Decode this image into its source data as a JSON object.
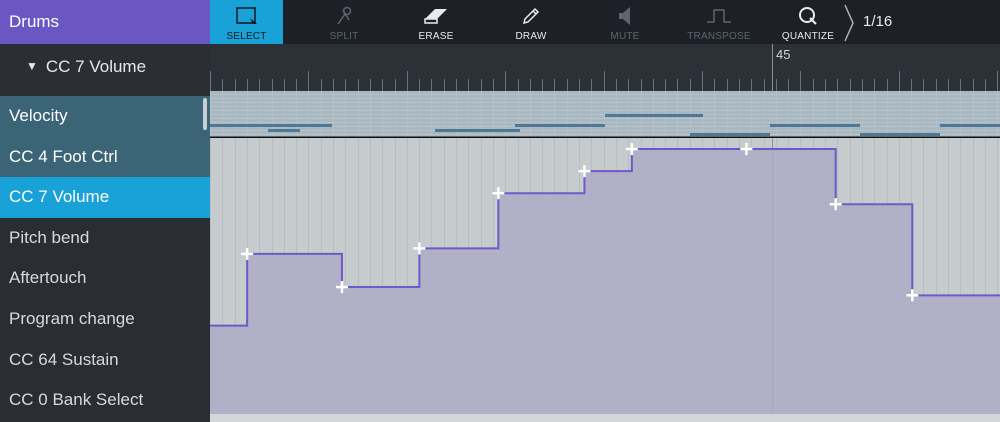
{
  "track": {
    "name": "Drums"
  },
  "cc_selector": {
    "label": "CC 7 Volume",
    "arrow_glyph": "▼"
  },
  "lanes": [
    {
      "label": "Velocity",
      "state": "used"
    },
    {
      "label": "CC 4 Foot Ctrl",
      "state": "used"
    },
    {
      "label": "CC 7 Volume",
      "state": "active"
    },
    {
      "label": "Pitch bend",
      "state": "normal"
    },
    {
      "label": "Aftertouch",
      "state": "normal"
    },
    {
      "label": "Program change",
      "state": "normal"
    },
    {
      "label": "CC 64 Sustain",
      "state": "normal"
    },
    {
      "label": "CC 0 Bank Select",
      "state": "normal"
    }
  ],
  "toolbar": {
    "tools": [
      {
        "label": "SELECT",
        "icon": "select-icon",
        "state": "selected"
      },
      {
        "label": "SPLIT",
        "icon": "scissors-icon",
        "state": "disabled"
      },
      {
        "label": "ERASE",
        "icon": "eraser-icon",
        "state": "enabled"
      },
      {
        "label": "DRAW",
        "icon": "pencil-icon",
        "state": "enabled"
      },
      {
        "label": "MUTE",
        "icon": "speaker-icon",
        "state": "disabled"
      },
      {
        "label": "TRANSPOSE",
        "icon": "transpose-icon",
        "state": "disabled"
      },
      {
        "label": "QUANTIZE",
        "icon": "quantize-icon",
        "state": "enabled"
      }
    ],
    "grid_value": "1/16"
  },
  "ruler": {
    "bar_label": "45"
  },
  "automation": {
    "line_color": "#6b5bc9",
    "fill_color": "#aeacc6",
    "points": [
      {
        "time": 0.047,
        "value": 0.58
      },
      {
        "time": 0.167,
        "value": 0.46
      },
      {
        "time": 0.265,
        "value": 0.6
      },
      {
        "time": 0.365,
        "value": 0.8
      },
      {
        "time": 0.474,
        "value": 0.88
      },
      {
        "time": 0.534,
        "value": 0.96
      },
      {
        "time": 0.679,
        "value": 0.96
      },
      {
        "time": 0.792,
        "value": 0.76
      },
      {
        "time": 0.889,
        "value": 0.43
      }
    ],
    "start_value": 0.32
  }
}
